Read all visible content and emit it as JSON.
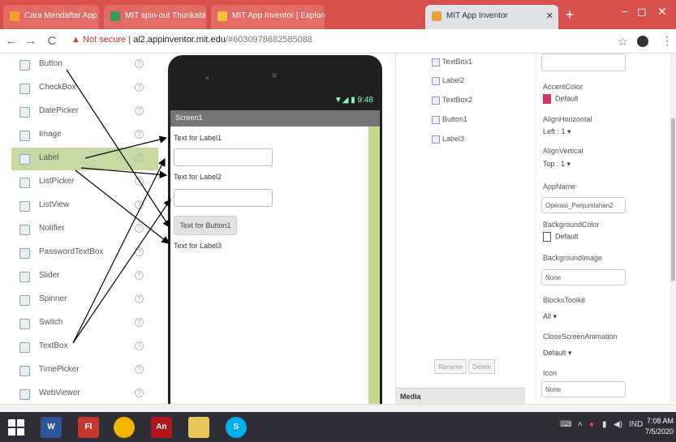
{
  "browser": {
    "tabs": [
      {
        "title": "Cara Mendaftar App Inventor",
        "fav_color": "#f0a030"
      },
      {
        "title": "MIT spin-out Thunkable hop",
        "fav_color": "#3a9a5b"
      },
      {
        "title": "MIT App Inventor | Explore M",
        "fav_color": "#f6c23e"
      },
      {
        "title": "MIT App Inventor",
        "fav_color": "#e9a23b"
      }
    ],
    "new_tab": "+",
    "minimize": "−",
    "maximize": "◻",
    "close": "✕",
    "back": "←",
    "forward": "→",
    "reload": "C",
    "security": "▲ Not secure",
    "host": "ai2.appinventor.mit.edu",
    "path": "/#6030978682585088",
    "star": "☆",
    "menu": "⋮"
  },
  "palette": {
    "items": [
      {
        "label": "Button",
        "selected": false
      },
      {
        "label": "CheckBox",
        "selected": false
      },
      {
        "label": "DatePicker",
        "selected": false
      },
      {
        "label": "Image",
        "selected": false
      },
      {
        "label": "Label",
        "selected": true
      },
      {
        "label": "ListPicker",
        "selected": false
      },
      {
        "label": "ListView",
        "selected": false
      },
      {
        "label": "Notifier",
        "selected": false
      },
      {
        "label": "PasswordTextBox",
        "selected": false
      },
      {
        "label": "Slider",
        "selected": false
      },
      {
        "label": "Spinner",
        "selected": false
      },
      {
        "label": "Switch",
        "selected": false
      },
      {
        "label": "TextBox",
        "selected": false
      },
      {
        "label": "TimePicker",
        "selected": false
      },
      {
        "label": "WebViewer",
        "selected": false
      }
    ],
    "help": "?"
  },
  "viewer": {
    "status": "▼◢ ▮ 9:48",
    "screen_title": "Screen1",
    "label1": "Text for Label1",
    "label2": "Text for Label2",
    "button1": "Text for Button1",
    "label3": "Text for Label3"
  },
  "components": {
    "items": [
      "TextBox1",
      "Label2",
      "TextBox2",
      "Button1",
      "Label3"
    ],
    "rename": "Rename",
    "delete": "Delete",
    "media": "Media"
  },
  "properties": {
    "accent_color_label": "AccentColor",
    "accent_color_value": "Default",
    "accent_color_hex": "#d6336c",
    "align_h_label": "AlignHorizontal",
    "align_h_value": "Left : 1 ▾",
    "align_v_label": "AlignVertical",
    "align_v_value": "Top : 1 ▾",
    "app_name_label": "AppName",
    "app_name_value": "Operasi_Penjumlahan2",
    "bg_color_label": "BackgroundColor",
    "bg_color_value": "Default",
    "bg_image_label": "BackgroundImage",
    "bg_image_value": "None",
    "blocks_toolkit_label": "BlocksToolkit",
    "blocks_toolkit_value": "All ▾",
    "close_anim_label": "CloseScreenAnimation",
    "close_anim_value": "Default ▾",
    "icon_label": "Icon",
    "icon_value": "None"
  },
  "taskbar": {
    "apps": [
      {
        "label": "W",
        "color": "#2b579a"
      },
      {
        "label": "Fl",
        "color": "#c6372c"
      },
      {
        "label": "",
        "color": "#f5b400"
      },
      {
        "label": "An",
        "color": "#b3151c"
      },
      {
        "label": "",
        "color": "#e8c659"
      },
      {
        "label": "S",
        "color": "#00aff0"
      }
    ],
    "tray_lang": "IND",
    "time": "7:08 AM",
    "date": "7/5/2020"
  }
}
